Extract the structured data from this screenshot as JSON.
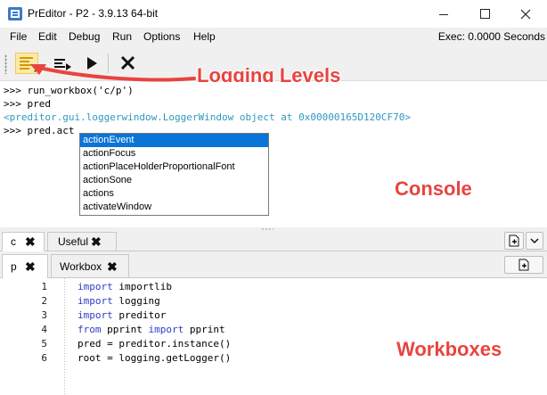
{
  "window": {
    "title": "PrEditor - P2 - 3.9.13 64-bit",
    "min_icon": "minimize-icon",
    "max_icon": "maximize-icon",
    "close_icon": "close-icon"
  },
  "menu": {
    "items": [
      "File",
      "Edit",
      "Debug",
      "Run",
      "Options",
      "Help"
    ],
    "exec_label": "Exec: 0.0000 Seconds"
  },
  "toolbar": {
    "buttons": [
      "logging-levels-icon",
      "run-selected-icon",
      "run-icon",
      "clear-icon"
    ]
  },
  "annotations": {
    "logging": "Logging Levels",
    "console": "Console",
    "workboxes": "Workboxes",
    "color": "#e8443f"
  },
  "console": {
    "lines": [
      ">>> run_workbox('c/p')",
      ">>> pred",
      "<preditor.gui.loggerwindow.LoggerWindow object at 0x00000165D120CF70>",
      ">>> pred.act"
    ]
  },
  "autocomplete": {
    "items": [
      "actionEvent",
      "actionFocus",
      "actionPlaceHolderProportionalFont",
      "actionSone",
      "actions",
      "activateWindow"
    ],
    "selected_index": 0,
    "selected_color": "#0a74d7"
  },
  "group_tabs": [
    {
      "label": "c",
      "active": true
    },
    {
      "label": "Useful",
      "active": false
    }
  ],
  "workbox_tabs": [
    {
      "label": "p",
      "active": true
    },
    {
      "label": "Workbox",
      "active": false
    }
  ],
  "editor": {
    "line_numbers": [
      "1",
      "2",
      "3",
      "4",
      "5",
      "6"
    ],
    "lines": [
      {
        "kw": "import",
        "rest": " importlib"
      },
      {
        "kw": "import",
        "rest": " logging"
      },
      {
        "kw": "import",
        "rest": " preditor"
      },
      {
        "kw": "from",
        "rest": " pprint ",
        "kw2": "import",
        "rest2": " pprint"
      },
      {
        "kw": "",
        "rest": "pred = preditor.instance()"
      },
      {
        "kw": "",
        "rest": "root = logging.getLogger()"
      }
    ]
  }
}
